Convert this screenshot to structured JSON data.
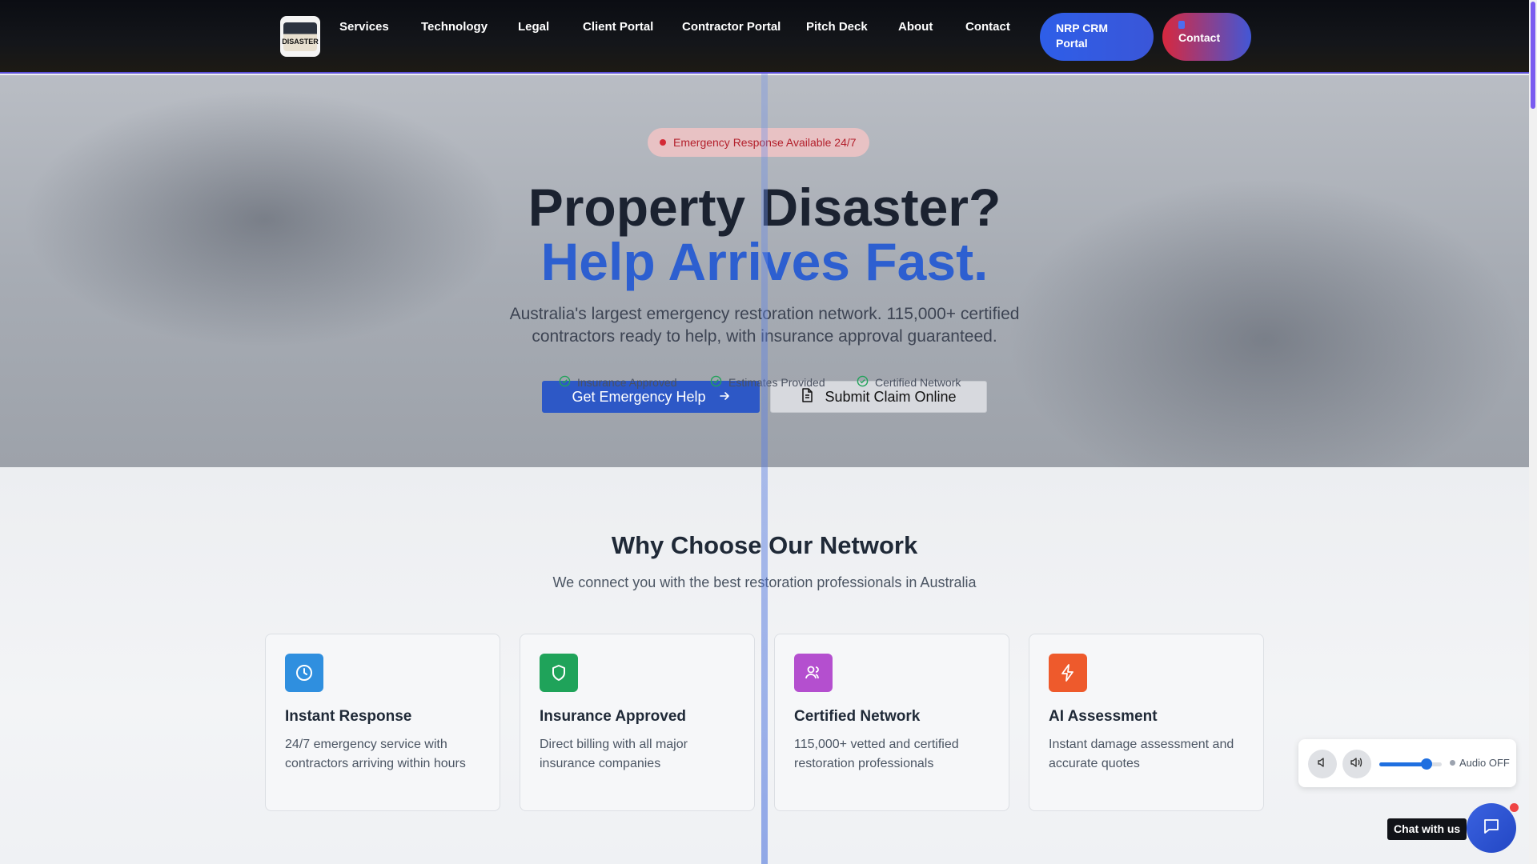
{
  "nav": {
    "links": [
      "Services",
      "Technology",
      "Legal",
      "Client Portal",
      "Contractor Portal",
      "Pitch Deck",
      "About",
      "Contact"
    ],
    "crm_button": "NRP CRM Portal",
    "contact_button": "Contact",
    "logo_text": "DISASTER"
  },
  "hero": {
    "badge": "Emergency Response Available 24/7",
    "title_line1": "Property Disaster?",
    "title_line2": "Help Arrives Fast.",
    "subtitle": "Australia's largest emergency restoration network. 115,000+ certified contractors ready to help, with insurance approval guaranteed.",
    "cta_primary": "Get Emergency Help",
    "cta_secondary": "Submit Claim Online",
    "trust": [
      "Insurance Approved",
      "Estimates Provided",
      "Certified Network"
    ]
  },
  "why": {
    "title": "Why Choose Our Network",
    "subtitle": "We connect you with the best restoration professionals in Australia",
    "cards": [
      {
        "icon": "clock-icon",
        "color": "#2f8fdf",
        "title": "Instant Response",
        "desc": "24/7 emergency service with contractors arriving within hours"
      },
      {
        "icon": "shield-icon",
        "color": "#1fa35a",
        "title": "Insurance Approved",
        "desc": "Direct billing with all major insurance companies"
      },
      {
        "icon": "users-icon",
        "color": "#b44fcf",
        "title": "Certified Network",
        "desc": "115,000+ vetted and certified restoration professionals"
      },
      {
        "icon": "lightning-icon",
        "color": "#ee5a2c",
        "title": "AI Assessment",
        "desc": "Instant damage assessment and accurate quotes"
      }
    ]
  },
  "audio": {
    "status": "Audio OFF",
    "volume": 0.75
  },
  "chat": {
    "label": "Chat with us"
  }
}
